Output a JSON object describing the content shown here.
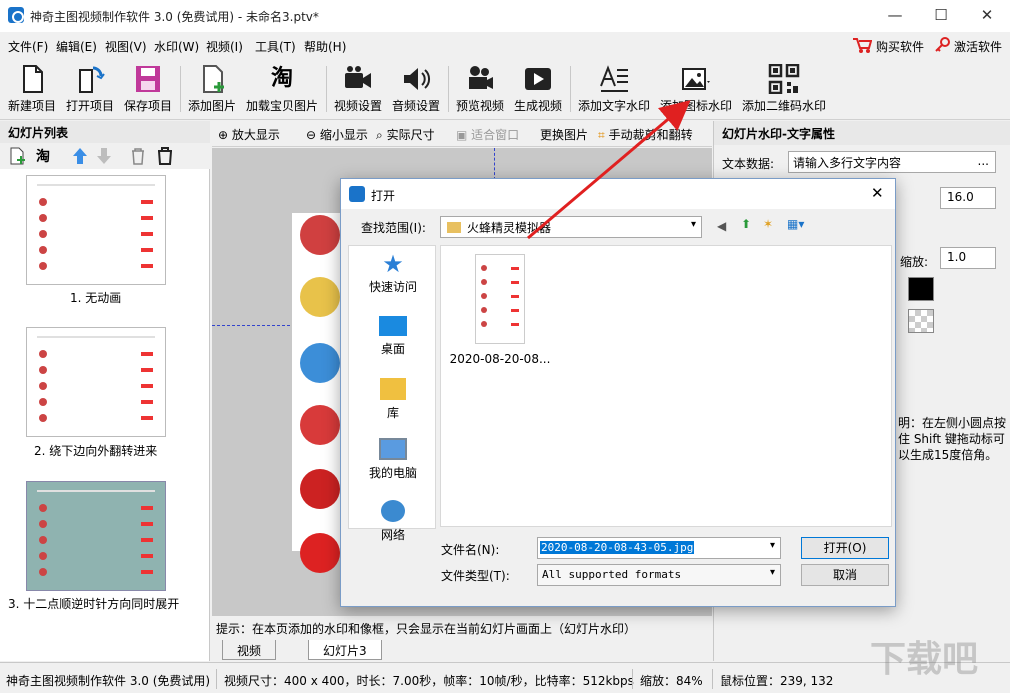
{
  "window": {
    "title": "神奇主图视频制作软件 3.0 (免费试用) - 未命名3.ptv*",
    "minimize": "—",
    "maximize": "☐",
    "close": "✕"
  },
  "menu": [
    "文件(F)",
    "编辑(E)",
    "视图(V)",
    "水印(W)",
    "视频(I)",
    "工具(T)",
    "帮助(H)"
  ],
  "menu_right": {
    "buy": "购买软件",
    "activate": "激活软件"
  },
  "toolbar": [
    "新建项目",
    "打开项目",
    "保存项目",
    "添加图片",
    "加载宝贝图片",
    "视频设置",
    "音频设置",
    "预览视频",
    "生成视频",
    "添加文字水印",
    "添加图标水印",
    "添加二维码水印"
  ],
  "left_panel": {
    "title": "幻灯片列表",
    "slides": [
      "1. 无动画",
      "2. 绕下边向外翻转进来",
      "3. 十二点顺逆时针方向同时展开"
    ]
  },
  "canvas_toolbar": [
    "放大显示",
    "缩小显示",
    "实际尺寸",
    "适合窗口",
    "更换图片",
    "手动裁剪和翻转"
  ],
  "hint": "提示：在本页添加的水印和像框，只会显示在当前幻灯片画面上（幻灯片水印）",
  "tabs": [
    "视频",
    "幻灯片3"
  ],
  "right_panel": {
    "title": "幻灯片水印-文字属性",
    "text_data_label": "文本数据:",
    "text_data_value": "请输入多行文字内容",
    "ellipsis": "...",
    "font_size": "16.0",
    "scale_label": "缩放:",
    "scale_value": "1.0",
    "note": "明：在左侧小圆点按住 Shift 键拖动标可以生成15度倍角。"
  },
  "dialog": {
    "title": "打开",
    "look_in_label": "查找范围(I):",
    "look_in_value": "火蜂精灵模拟器",
    "places": [
      "快速访问",
      "桌面",
      "库",
      "我的电脑",
      "网络"
    ],
    "file_item": "2020-08-20-08...",
    "filename_label": "文件名(N):",
    "filename_value": "2020-08-20-08-43-05.jpg",
    "filetype_label": "文件类型(T):",
    "filetype_value": "All supported formats",
    "open_button": "打开(O)",
    "cancel_button": "取消"
  },
  "status": [
    "神奇主图视频制作软件 3.0 (免费试用)",
    "视频尺寸：400 x 400，时长：7.00秒，帧率：10帧/秒，比特率：512kbps",
    "缩放：84%",
    "鼠标位置：239, 132"
  ],
  "watermark": "下载吧",
  "colors": {
    "accent": "#1a73c9",
    "arrow": "#e02020"
  }
}
